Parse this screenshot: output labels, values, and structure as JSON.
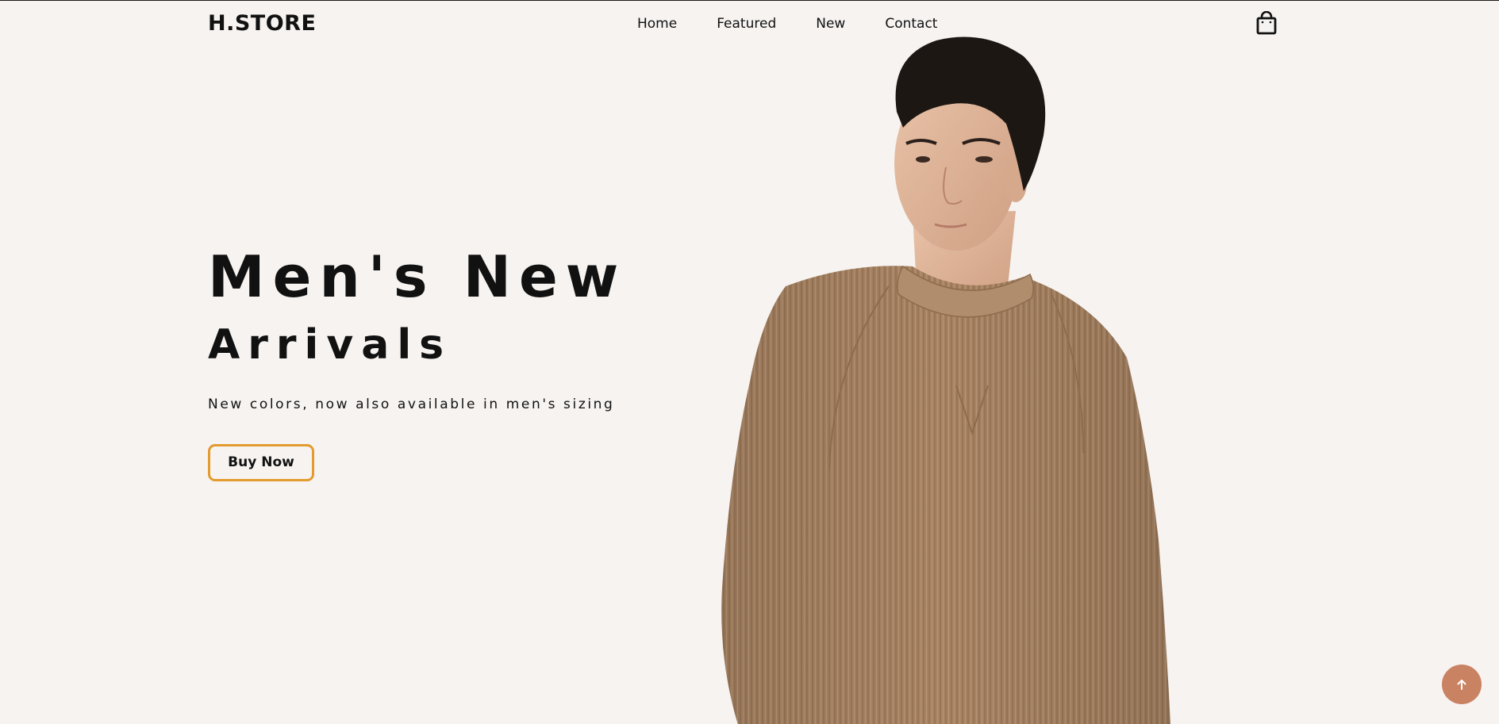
{
  "header": {
    "logo": "H.STORE",
    "nav": [
      "Home",
      "Featured",
      "New",
      "Contact"
    ],
    "cart_icon": "shopping-bag-icon"
  },
  "hero": {
    "title_line1": "Men's New",
    "title_line2": "Arrivals",
    "subtitle": "New colors, now also available in men's sizing",
    "cta_label": "Buy Now",
    "image": "man-in-brown-sweater-photo"
  },
  "scroll_top_icon": "arrow-up-icon",
  "colors": {
    "background": "#f6f3f1",
    "text": "#111111",
    "cta_border": "#e39b2e",
    "scroll_button": "#c98363",
    "sweater": "#a88464"
  }
}
